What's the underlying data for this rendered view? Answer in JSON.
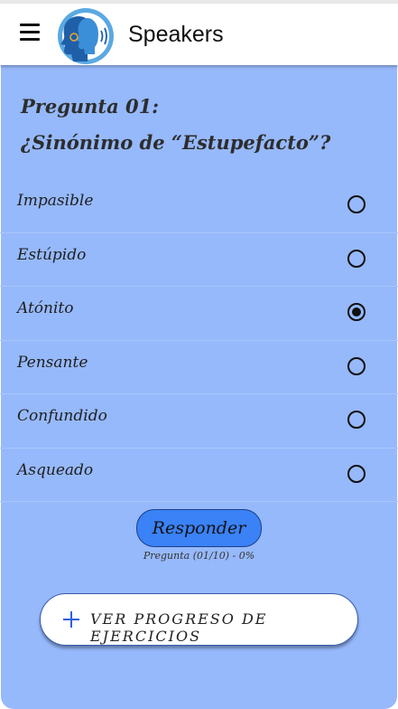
{
  "app": {
    "title": "Speakers"
  },
  "question": {
    "number_label": "Pregunta 01:",
    "text": "¿Sinónimo de “Estupefacto”?"
  },
  "options": [
    {
      "label": "Impasible",
      "selected": false
    },
    {
      "label": "Estúpido",
      "selected": false
    },
    {
      "label": "Atónito",
      "selected": true
    },
    {
      "label": "Pensante",
      "selected": false
    },
    {
      "label": "Confundido",
      "selected": false
    },
    {
      "label": "Asqueado",
      "selected": false
    }
  ],
  "actions": {
    "respond_label": "Responder",
    "progress_text": "Pregunta (01/10) - 0%",
    "view_progress_label": "VER PROGRESO DE EJERCICIOS"
  },
  "colors": {
    "card_background": "#96b9fb",
    "respond_button": "#3a82f6",
    "plus_icon": "#2f5fe0"
  },
  "icons": [
    "menu-icon",
    "app-logo",
    "plus-icon"
  ]
}
